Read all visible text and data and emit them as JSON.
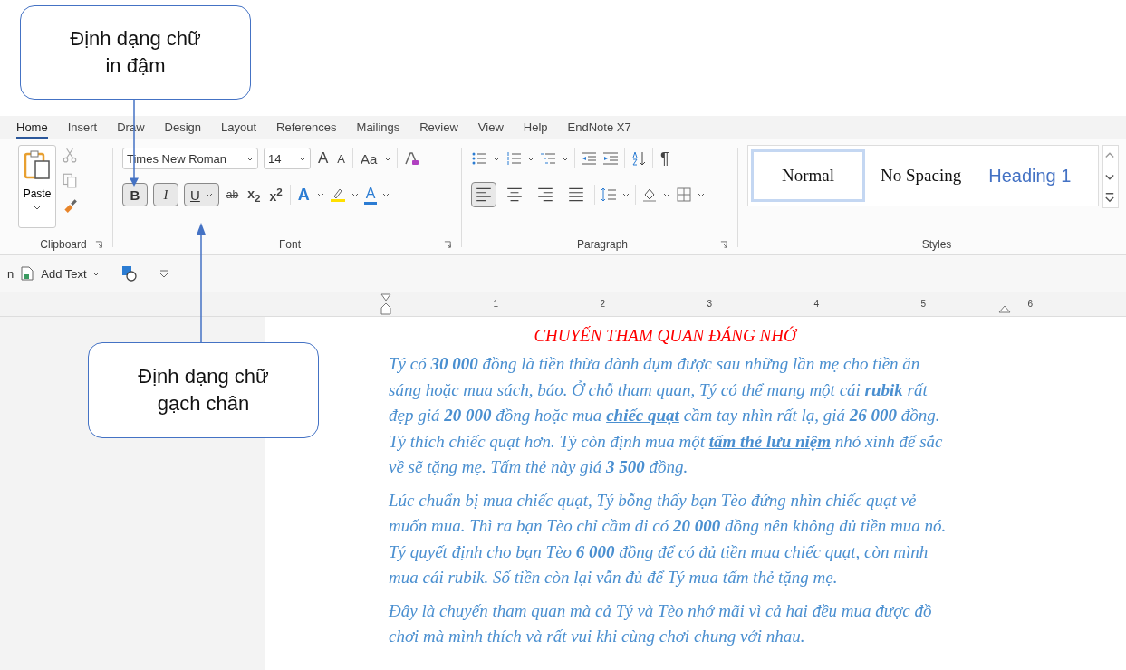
{
  "callouts": [
    {
      "text": "Định dạng chữ in đậm"
    },
    {
      "text": "Định dạng chữ gạch chân"
    }
  ],
  "tabs": [
    {
      "label": "Home",
      "selected": true
    },
    {
      "label": "Insert",
      "selected": false
    },
    {
      "label": "Draw",
      "selected": false
    },
    {
      "label": "Design",
      "selected": false
    },
    {
      "label": "Layout",
      "selected": false
    },
    {
      "label": "References",
      "selected": false
    },
    {
      "label": "Mailings",
      "selected": false
    },
    {
      "label": "Review",
      "selected": false
    },
    {
      "label": "View",
      "selected": false
    },
    {
      "label": "Help",
      "selected": false
    },
    {
      "label": "EndNote X7",
      "selected": false
    }
  ],
  "clipboard": {
    "paste_label": "Paste",
    "group_label": "Clipboard"
  },
  "font": {
    "name": "Times New Roman",
    "size": "14",
    "grow": "A",
    "shrink": "A",
    "change_case": "Aa",
    "bold": "B",
    "italic": "I",
    "underline": "U",
    "strikethrough": "ab",
    "subscript": "x$_{2}$",
    "superscript": "x$^{2}$",
    "text_effects": "A",
    "font_color": "A",
    "group_label": "Font",
    "bold_on": true,
    "italic_on": true,
    "underline_on": true
  },
  "paragraph": {
    "pilcrow": "¶",
    "group_label": "Paragraph",
    "alignments": [
      {
        "kind": "left",
        "selected": true
      },
      {
        "kind": "center",
        "selected": false
      },
      {
        "kind": "right",
        "selected": false
      },
      {
        "kind": "justify",
        "selected": false
      }
    ]
  },
  "styles": {
    "group_label": "Styles",
    "items": [
      {
        "label": "Normal",
        "kind": "normal",
        "selected": true
      },
      {
        "label": "No Spacing",
        "kind": "nospacing",
        "selected": false
      },
      {
        "label": "Heading 1",
        "kind": "heading",
        "selected": false
      }
    ]
  },
  "quick_access": {
    "cut_text": "n",
    "add_text": "Add Text"
  },
  "ruler": {
    "numbers": [
      "1",
      "2",
      "3",
      "4",
      "5",
      "6"
    ]
  },
  "document": {
    "title": "CHUYẾN THAM QUAN ĐÁNG NHỚ",
    "paragraphs": [
      [
        [
          {
            "text": "Tý có ",
            "bold": false,
            "underline": false
          },
          {
            "text": "30 000",
            "bold": true,
            "underline": false
          },
          {
            "text": " đồng là tiền thừa dành dụm được sau những lần mẹ cho tiền ăn",
            "bold": false,
            "underline": false
          }
        ],
        [
          {
            "text": "sáng hoặc mua sách, báo. Ở chỗ tham quan, Tý có thể mang một cái ",
            "bold": false,
            "underline": false
          },
          {
            "text": "rubik",
            "bold": true,
            "underline": true
          },
          {
            "text": " rất",
            "bold": false,
            "underline": false
          }
        ],
        [
          {
            "text": "đẹp giá ",
            "bold": false,
            "underline": false
          },
          {
            "text": "20 000",
            "bold": true,
            "underline": false
          },
          {
            "text": " đồng hoặc mua ",
            "bold": false,
            "underline": false
          },
          {
            "text": "chiếc quạt",
            "bold": true,
            "underline": true
          },
          {
            "text": " cầm tay nhìn rất lạ, giá ",
            "bold": false,
            "underline": false
          },
          {
            "text": "26 000",
            "bold": true,
            "underline": false
          },
          {
            "text": " đồng.",
            "bold": false,
            "underline": false
          }
        ],
        [
          {
            "text": "Tý thích chiếc quạt hơn. Tý còn định mua một ",
            "bold": false,
            "underline": false
          },
          {
            "text": "tấm thẻ lưu niệm",
            "bold": true,
            "underline": true
          },
          {
            "text": " nhỏ xinh để sắc",
            "bold": false,
            "underline": false
          }
        ],
        [
          {
            "text": "về sẽ tặng mẹ. Tấm thẻ này giá ",
            "bold": false,
            "underline": false
          },
          {
            "text": "3 500",
            "bold": true,
            "underline": false
          },
          {
            "text": " đồng.",
            "bold": false,
            "underline": false
          }
        ]
      ],
      [
        [
          {
            "text": "Lúc chuẩn bị mua chiếc quạt, Tý bỗng thấy bạn Tèo đứng nhìn chiếc quạt vẻ",
            "bold": false,
            "underline": false
          }
        ],
        [
          {
            "text": "muốn mua. Thì ra bạn Tèo chỉ cầm đi có ",
            "bold": false,
            "underline": false
          },
          {
            "text": "20 000",
            "bold": true,
            "underline": false
          },
          {
            "text": " đồng nên không đủ tiền mua nó.",
            "bold": false,
            "underline": false
          }
        ],
        [
          {
            "text": "Tý quyết định cho bạn Tèo ",
            "bold": false,
            "underline": false
          },
          {
            "text": "6 000",
            "bold": true,
            "underline": false
          },
          {
            "text": " đồng để có đủ tiền mua chiếc quạt, còn mình",
            "bold": false,
            "underline": false
          }
        ],
        [
          {
            "text": "mua cái rubik. Số tiền còn lại vẫn đủ để Tý mua tấm thẻ tặng mẹ.",
            "bold": false,
            "underline": false
          }
        ]
      ],
      [
        [
          {
            "text": "Đây là chuyến tham quan mà cả Tý và Tèo nhớ mãi vì cả hai đều mua được đồ",
            "bold": false,
            "underline": false
          }
        ],
        [
          {
            "text": "chơi mà mình thích và rất vui khi cùng chơi chung với nhau.",
            "bold": false,
            "underline": false
          }
        ]
      ]
    ]
  }
}
